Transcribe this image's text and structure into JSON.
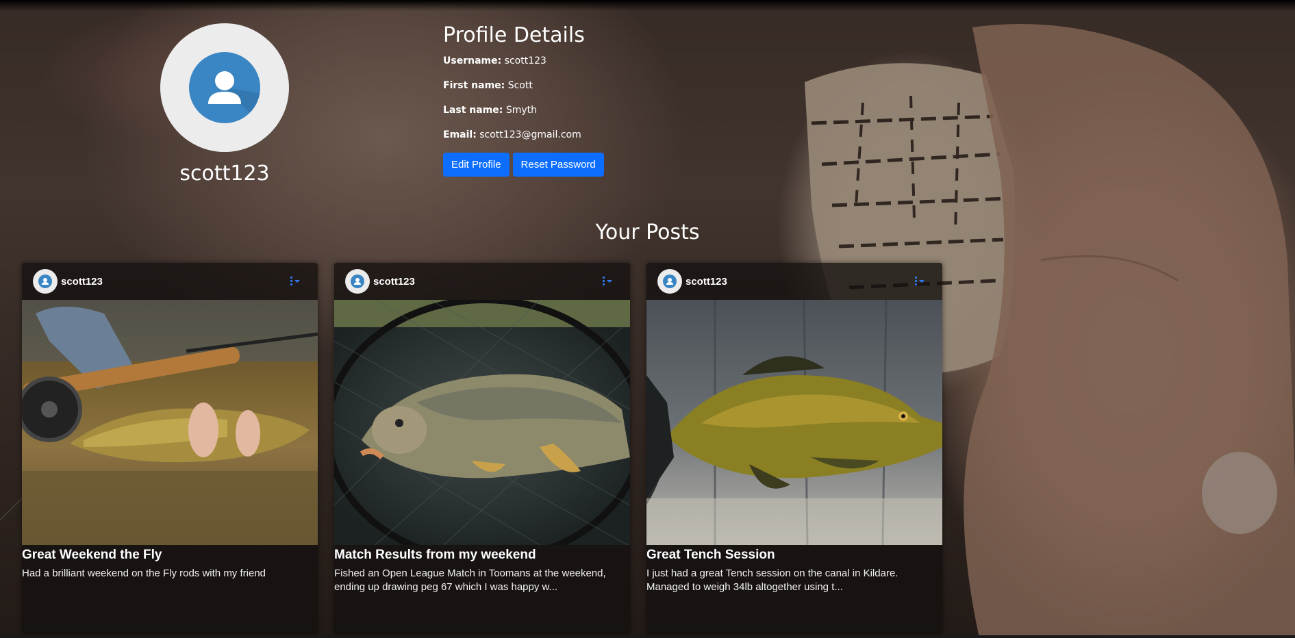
{
  "profile": {
    "username": "scott123",
    "details_title": "Profile Details",
    "fields": {
      "username_label": "Username:",
      "username_value": "scott123",
      "first_name_label": "First name:",
      "first_name_value": "Scott",
      "last_name_label": "Last name:",
      "last_name_value": "Smyth",
      "email_label": "Email:",
      "email_value": "scott123@gmail.com"
    },
    "buttons": {
      "edit": "Edit Profile",
      "reset": "Reset Password"
    },
    "avatar_icon": "user-avatar-icon"
  },
  "posts_section": {
    "title": "Your Posts",
    "posts": [
      {
        "author": "scott123",
        "title": "Great Weekend the Fly",
        "text": "Had a brilliant weekend on the Fly rods with my friend"
      },
      {
        "author": "scott123",
        "title": "Match Results from my weekend",
        "text": "Fished an Open League Match in Toomans at the weekend, ending up drawing peg 67 which I was happy w..."
      },
      {
        "author": "scott123",
        "title": "Great Tench Session",
        "text": "I just had a great Tench session on the canal in Kildare. Managed to weigh 34lb altogether using t..."
      }
    ]
  },
  "colors": {
    "primary_button": "#0d6efd",
    "avatar_blue": "#3a86c4"
  }
}
